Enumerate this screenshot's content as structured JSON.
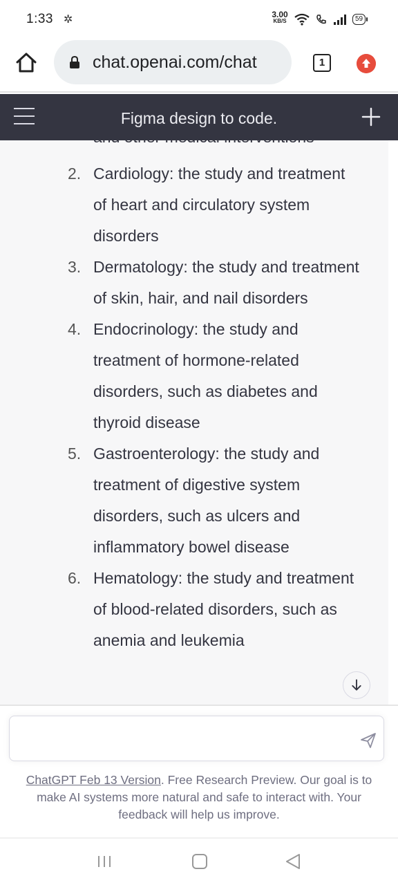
{
  "status_bar": {
    "time": "1:33",
    "speed_value": "3.00",
    "speed_unit": "KB/S",
    "battery": "59"
  },
  "browser": {
    "url": "chat.openai.com/chat",
    "tab_count": "1"
  },
  "header": {
    "title": "Figma design to code."
  },
  "chat": {
    "cut_off_text": "and other medical interventions",
    "list_items": [
      {
        "number": "2.",
        "text": "Cardiology: the study and treatment of heart and circulatory system disorders"
      },
      {
        "number": "3.",
        "text": "Dermatology: the study and treatment of skin, hair, and nail disorders"
      },
      {
        "number": "4.",
        "text": "Endocrinology: the study and treatment of hormone-related disorders, such as diabetes and thyroid disease"
      },
      {
        "number": "5.",
        "text": "Gastroenterology: the study and treatment of digestive system disorders, such as ulcers and inflammatory bowel disease"
      },
      {
        "number": "6.",
        "text": "Hematology: the study and treatment of blood-related disorders, such as anemia and leukemia"
      }
    ]
  },
  "input": {
    "placeholder": "",
    "value": ""
  },
  "footer": {
    "version_link": "ChatGPT Feb 13 Version",
    "disclaimer": ". Free Research Preview. Our goal is to make AI systems more natural and safe to interact with. Your feedback will help us improve."
  },
  "colors": {
    "header_bg": "#343541",
    "chat_bg": "#f7f7f8",
    "update_badge": "#e74c3c"
  }
}
